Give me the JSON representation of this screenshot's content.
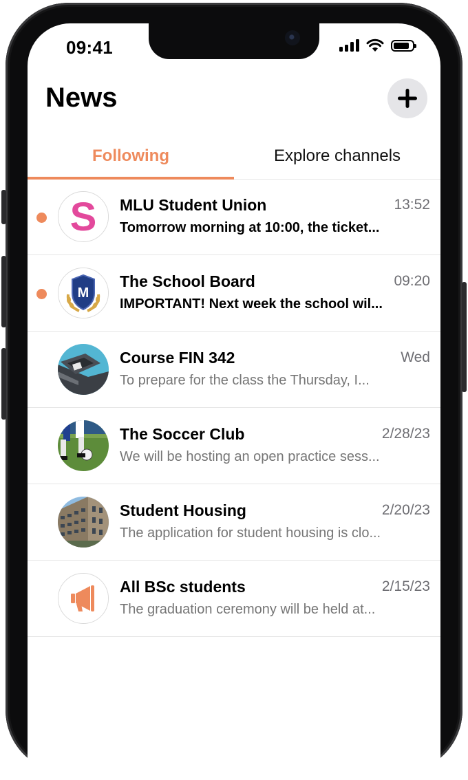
{
  "status_bar": {
    "time": "09:41"
  },
  "header": {
    "title": "News"
  },
  "tabs": [
    {
      "label": "Following",
      "active": true
    },
    {
      "label": "Explore channels",
      "active": false
    }
  ],
  "colors": {
    "accent": "#ee8a5c",
    "muted_text": "#767676"
  },
  "channels": [
    {
      "name": "MLU Student Union",
      "time": "13:52",
      "preview": "Tomorrow morning at 10:00, the ticket...",
      "unread": true,
      "avatar": "letter-s-avatar"
    },
    {
      "name": "The School Board",
      "time": "09:20",
      "preview": "IMPORTANT! Next week the school wil...",
      "unread": true,
      "avatar": "shield-crest-avatar"
    },
    {
      "name": "Course FIN 342",
      "time": "Wed",
      "preview": "To prepare for the class the Thursday, I...",
      "unread": false,
      "avatar": "laptop-photo-avatar"
    },
    {
      "name": "The Soccer Club",
      "time": "2/28/23",
      "preview": "We will be hosting an open practice sess...",
      "unread": false,
      "avatar": "soccer-photo-avatar"
    },
    {
      "name": "Student Housing",
      "time": "2/20/23",
      "preview": "The application for student housing is clo...",
      "unread": false,
      "avatar": "building-photo-avatar"
    },
    {
      "name": "All BSc students",
      "time": "2/15/23",
      "preview": "The graduation ceremony will be held at...",
      "unread": false,
      "avatar": "megaphone-avatar"
    }
  ]
}
